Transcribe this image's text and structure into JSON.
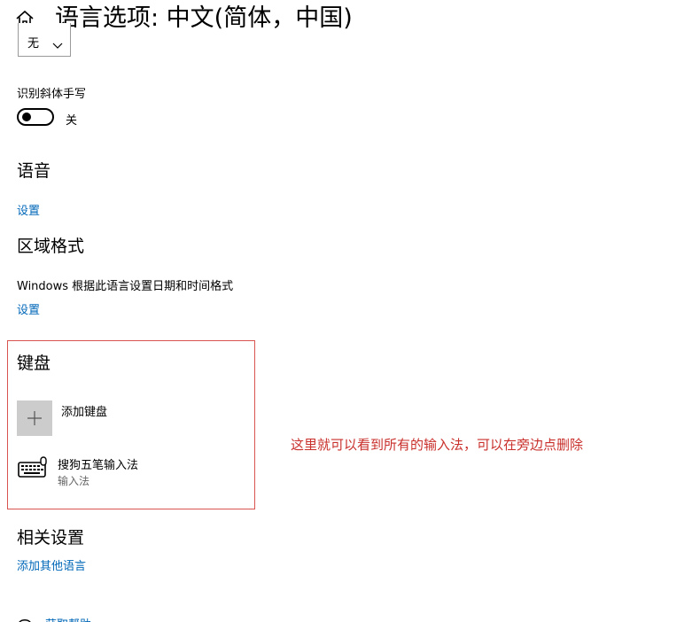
{
  "header": {
    "title": "语言选项: 中文(简体，中国)",
    "home_icon": "home-icon"
  },
  "handwriting": {
    "dropdown_value": "无",
    "italic_label": "识别斜体手写",
    "toggle_state": "关",
    "toggle_on": false
  },
  "speech": {
    "heading": "语音",
    "settings_link": "设置"
  },
  "region": {
    "heading": "区域格式",
    "description": "Windows 根据此语言设置日期和时间格式",
    "settings_link": "设置"
  },
  "keyboard": {
    "heading": "键盘",
    "add_label": "添加键盘",
    "items": [
      {
        "name": "搜狗五笔输入法",
        "type": "输入法",
        "icon": "keyboard-icon"
      }
    ]
  },
  "annotation": {
    "text": "这里就可以看到所有的输入法，可以在旁边点删除",
    "color": "#c9302c"
  },
  "related": {
    "heading": "相关设置",
    "add_language_link": "添加其他语言",
    "help_link": "获取帮助"
  },
  "colors": {
    "link": "#0067b8",
    "tile": "#cccccc",
    "highlight_border": "#d9534f"
  }
}
